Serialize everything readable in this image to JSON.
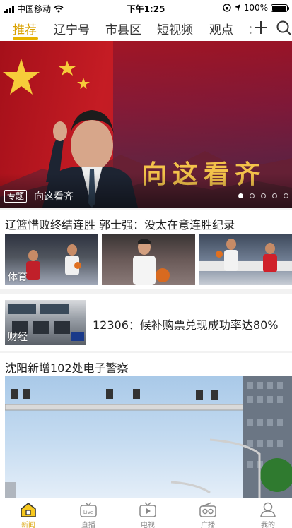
{
  "status_bar": {
    "carrier": "中国移动",
    "time": "下午1:25",
    "battery": "100%",
    "battery_level": 1.0
  },
  "tabs": [
    {
      "label": "推荐",
      "active": true
    },
    {
      "label": "辽宁号",
      "active": false
    },
    {
      "label": "市县区",
      "active": false
    },
    {
      "label": "短视频",
      "active": false
    },
    {
      "label": "观点",
      "active": false
    },
    {
      "label": "：",
      "active": false
    }
  ],
  "tab_icons": {
    "add": "plus-icon",
    "search": "search-icon"
  },
  "banner": {
    "slogan": "向这看齐",
    "tag": "专题",
    "caption": "向这看齐",
    "page_count": 5,
    "current_page": 1
  },
  "articles": [
    {
      "title": "辽篮惜败终结连胜 郭士强：没太在意连胜纪录",
      "category": "体育",
      "layout": "three-images"
    },
    {
      "title": "12306：候补购票兑现成功率达80%",
      "category": "财经",
      "layout": "left-image"
    },
    {
      "title": "沈阳新增102处电子警察",
      "layout": "large-image"
    }
  ],
  "bottom_nav": [
    {
      "label": "新闻",
      "icon": "home-icon",
      "active": true
    },
    {
      "label": "直播",
      "icon": "live-tv-icon",
      "active": false
    },
    {
      "label": "电视",
      "icon": "tv-play-icon",
      "active": false
    },
    {
      "label": "广播",
      "icon": "radio-icon",
      "active": false
    },
    {
      "label": "我的",
      "icon": "user-icon",
      "active": false
    }
  ],
  "colors": {
    "accent": "#e8b400",
    "banner_red": "#c51c24",
    "slogan_gold": "#f3c24a"
  }
}
